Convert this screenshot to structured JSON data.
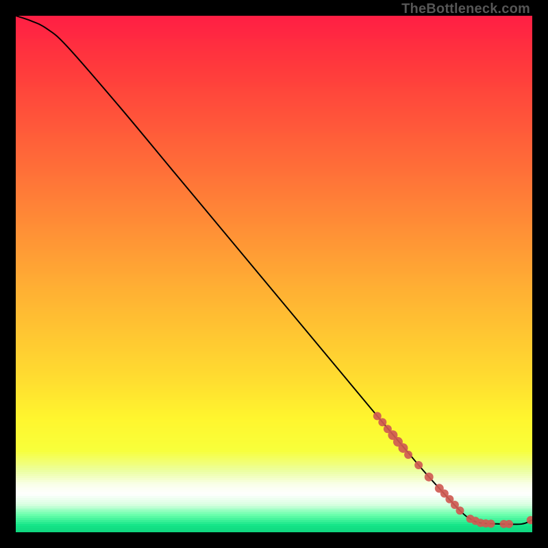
{
  "attribution": "TheBottleneck.com",
  "chart_data": {
    "type": "line",
    "title": "",
    "xlabel": "",
    "ylabel": "",
    "xlim": [
      0,
      100
    ],
    "ylim": [
      0,
      100
    ],
    "grid": false,
    "curve": {
      "name": "bottleneck-curve",
      "x": [
        0,
        3,
        6,
        10,
        20,
        30,
        40,
        50,
        60,
        70,
        78,
        82,
        86,
        88,
        90,
        94,
        98,
        100
      ],
      "y": [
        100,
        99,
        97.5,
        94,
        82.5,
        70.5,
        58.5,
        46.5,
        34.5,
        22.5,
        13,
        8.5,
        4.2,
        2.6,
        1.8,
        1.6,
        1.6,
        2.4
      ]
    },
    "markers": {
      "name": "highlighted-points",
      "color": "#cf5a53",
      "x": [
        70,
        71,
        72,
        73,
        74,
        75,
        76,
        78,
        80,
        82,
        83,
        84,
        85,
        86,
        88,
        89,
        90,
        91,
        92,
        94.5,
        95.5,
        99.7
      ],
      "y": [
        22.5,
        21.3,
        20,
        18.8,
        17.5,
        16.3,
        15,
        13,
        10.7,
        8.5,
        7.5,
        6.4,
        5.3,
        4.2,
        2.6,
        2.2,
        1.8,
        1.7,
        1.65,
        1.6,
        1.6,
        2.35
      ],
      "r": [
        6,
        6,
        6,
        7,
        7,
        7,
        6,
        6,
        6.5,
        6.5,
        6,
        6,
        6,
        6,
        6,
        6,
        6,
        6,
        6,
        6,
        6,
        6
      ]
    },
    "gradient_stops": [
      {
        "pos": 0.0,
        "color": "#ff1f44"
      },
      {
        "pos": 0.1,
        "color": "#ff3a3c"
      },
      {
        "pos": 0.2,
        "color": "#ff553a"
      },
      {
        "pos": 0.3,
        "color": "#ff7038"
      },
      {
        "pos": 0.4,
        "color": "#ff8c36"
      },
      {
        "pos": 0.5,
        "color": "#ffa834"
      },
      {
        "pos": 0.6,
        "color": "#ffc232"
      },
      {
        "pos": 0.7,
        "color": "#ffdc30"
      },
      {
        "pos": 0.78,
        "color": "#fff62e"
      },
      {
        "pos": 0.84,
        "color": "#f8ff3a"
      },
      {
        "pos": 0.88,
        "color": "#ecffa0"
      },
      {
        "pos": 0.905,
        "color": "#f9ffe8"
      },
      {
        "pos": 0.925,
        "color": "#ffffff"
      },
      {
        "pos": 0.945,
        "color": "#d8ffe0"
      },
      {
        "pos": 0.965,
        "color": "#6cffad"
      },
      {
        "pos": 0.985,
        "color": "#14e588"
      },
      {
        "pos": 1.0,
        "color": "#0fd47d"
      }
    ]
  }
}
